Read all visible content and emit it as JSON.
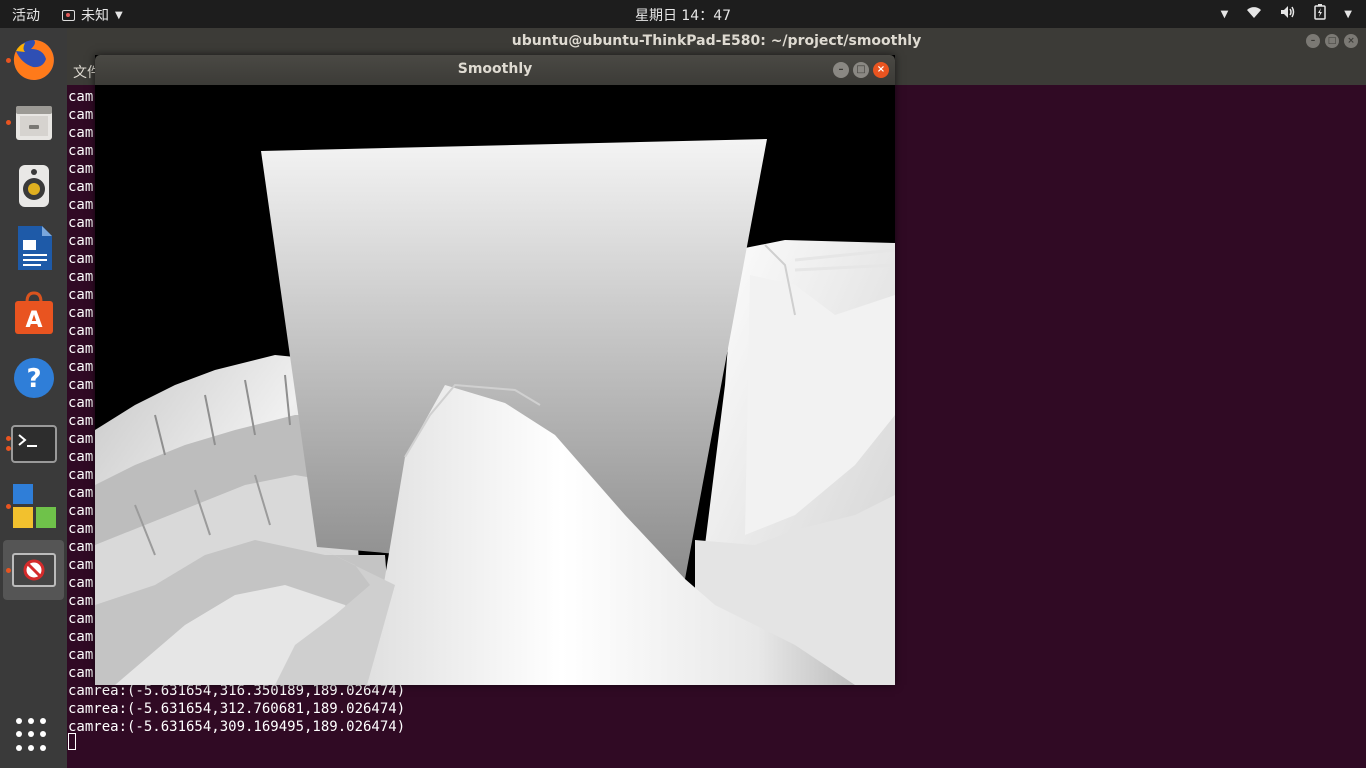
{
  "topbar": {
    "activities": "活动",
    "app_name": "未知",
    "clock": "星期日 14：47",
    "tray_icons": [
      "network-wired-icon",
      "wifi-icon",
      "volume-icon",
      "battery-icon",
      "power-menu-icon"
    ]
  },
  "launcher": {
    "items": [
      {
        "name": "firefox",
        "icon": "firefox-icon",
        "running": true
      },
      {
        "name": "files",
        "icon": "files-icon",
        "running": true
      },
      {
        "name": "rhythmbox",
        "icon": "speaker-icon",
        "running": false
      },
      {
        "name": "writer",
        "icon": "document-icon",
        "running": false
      },
      {
        "name": "software",
        "icon": "shopping-bag-icon",
        "running": false
      },
      {
        "name": "help",
        "icon": "help-icon",
        "running": false
      },
      {
        "name": "terminal",
        "icon": "terminal-icon",
        "running": true
      },
      {
        "name": "unknown-app",
        "icon": "app-blocks-icon",
        "running": true
      },
      {
        "name": "smoothly",
        "icon": "blocked-icon",
        "running": true
      }
    ]
  },
  "terminal": {
    "title": "ubuntu@ubuntu-ThinkPad-E580: ~/project/smoothly",
    "menu_label": "文件",
    "truncated_prefix": "cam",
    "visible_lines": [
      "camrea:(-5.631654,316.350189,189.026474)",
      "camrea:(-5.631654,312.760681,189.026474)",
      "camrea:(-5.631654,309.169495,189.026474)"
    ]
  },
  "smoothly": {
    "title": "Smoothly"
  },
  "colors": {
    "desktop_bg": "#300a24",
    "accent": "#e95420",
    "panel": "#3c3b37"
  }
}
